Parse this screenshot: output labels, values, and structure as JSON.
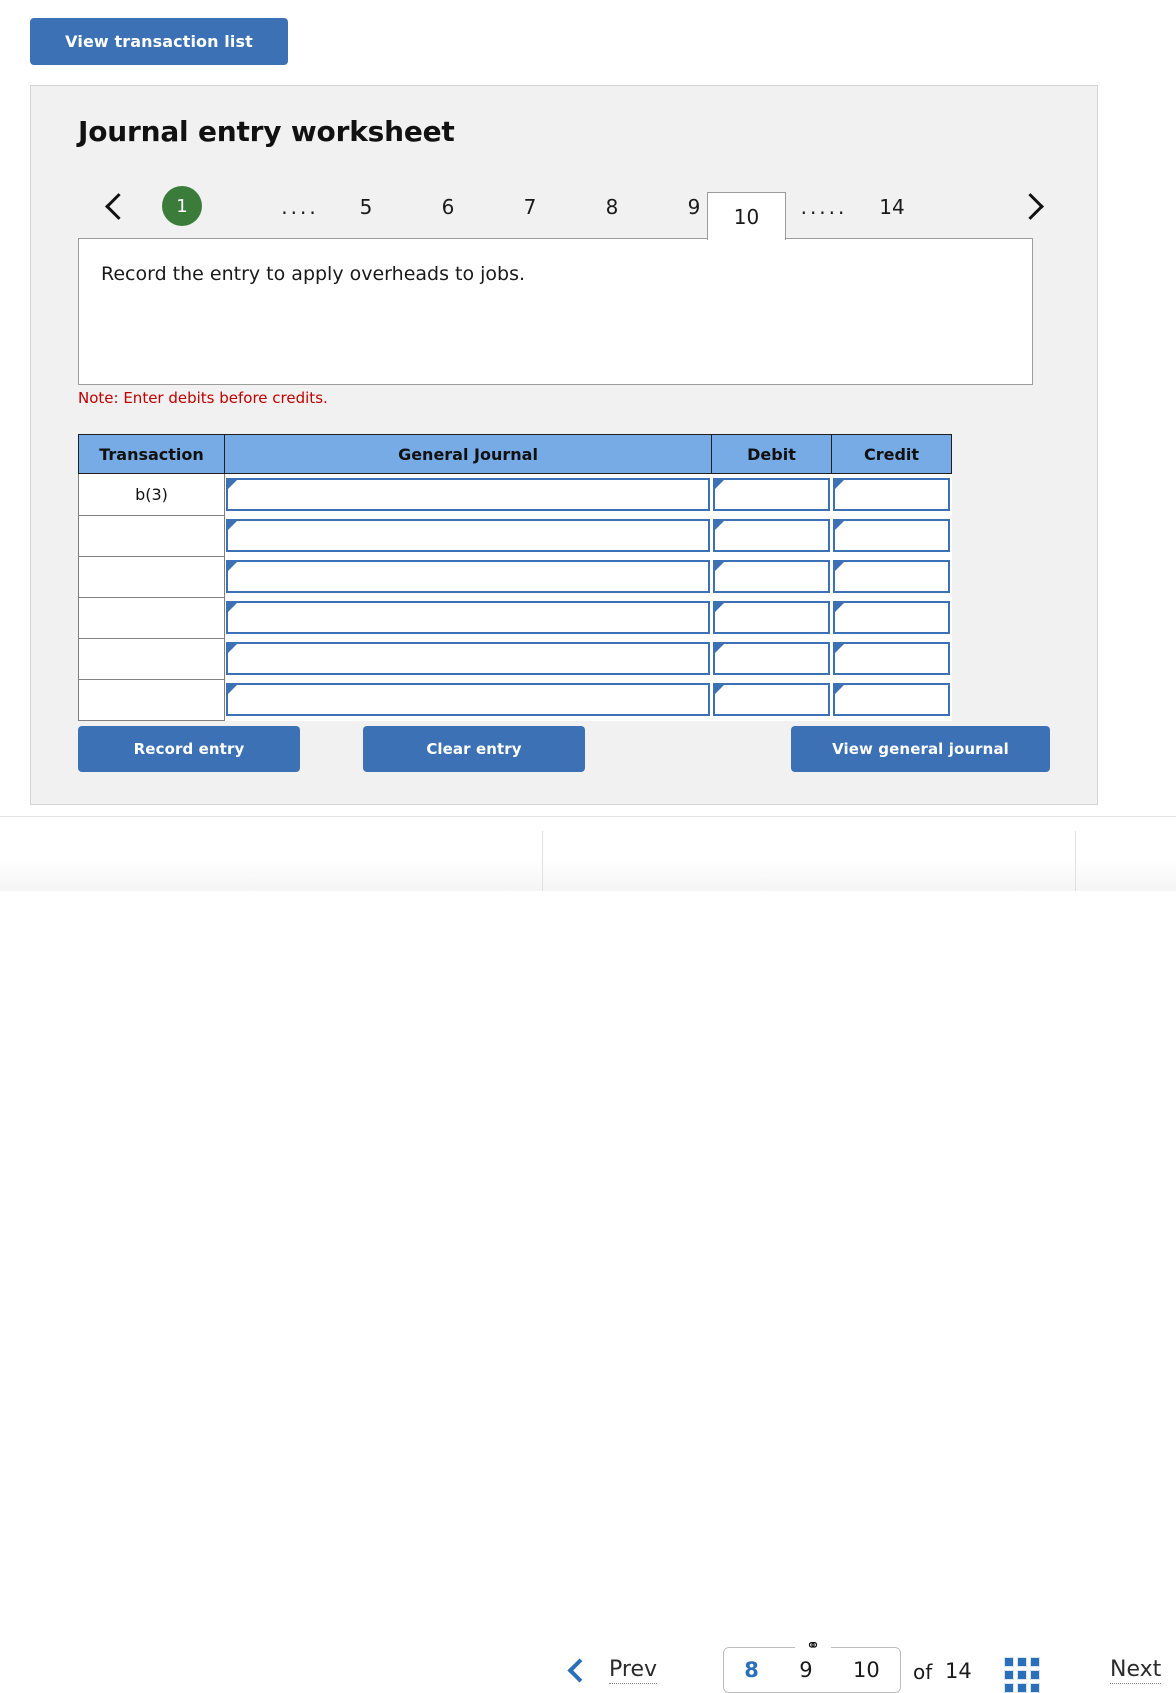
{
  "top": {
    "view_transaction_list": "View transaction list"
  },
  "panel": {
    "title": "Journal entry worksheet",
    "note": "Note: Enter debits before credits.",
    "description": "Record the entry to apply overheads to jobs."
  },
  "tabs": {
    "prev_icon": "chevron-left-icon",
    "next_icon": "chevron-right-icon",
    "items": [
      {
        "label": "1",
        "state": "completed"
      },
      {
        "label": "....",
        "state": "dots"
      },
      {
        "label": "5",
        "state": "normal"
      },
      {
        "label": "6",
        "state": "normal"
      },
      {
        "label": "7",
        "state": "normal"
      },
      {
        "label": "8",
        "state": "normal"
      },
      {
        "label": "9",
        "state": "normal"
      },
      {
        "label": "10",
        "state": "active"
      },
      {
        "label": ".....",
        "state": "dots"
      },
      {
        "label": "14",
        "state": "normal"
      }
    ]
  },
  "journal": {
    "headers": {
      "transaction": "Transaction",
      "general_journal": "General Journal",
      "debit": "Debit",
      "credit": "Credit"
    },
    "rows": [
      {
        "transaction": "b(3)",
        "general_journal": "",
        "debit": "",
        "credit": ""
      },
      {
        "transaction": "",
        "general_journal": "",
        "debit": "",
        "credit": ""
      },
      {
        "transaction": "",
        "general_journal": "",
        "debit": "",
        "credit": ""
      },
      {
        "transaction": "",
        "general_journal": "",
        "debit": "",
        "credit": ""
      },
      {
        "transaction": "",
        "general_journal": "",
        "debit": "",
        "credit": ""
      },
      {
        "transaction": "",
        "general_journal": "",
        "debit": "",
        "credit": ""
      }
    ]
  },
  "actions": {
    "record_entry": "Record entry",
    "clear_entry": "Clear entry",
    "view_general_journal": "View general journal"
  },
  "bottom_nav": {
    "prev": "Prev",
    "next": "Next",
    "prev_icon": "chevron-left-icon",
    "link_icon": "⚭",
    "pages": [
      {
        "label": "8",
        "current": true
      },
      {
        "label": "9",
        "current": false
      },
      {
        "label": "10",
        "current": false
      }
    ],
    "of_label": "of",
    "total_pages": "14",
    "grid_icon": "grid-view-icon"
  },
  "colors": {
    "button_blue": "#3C72B5",
    "header_blue": "#76ABE5",
    "accent_blue": "#2B6FB8",
    "completed_green": "#3B7C3B",
    "note_red": "#C00000",
    "panel_bg": "#F1F1F1"
  }
}
